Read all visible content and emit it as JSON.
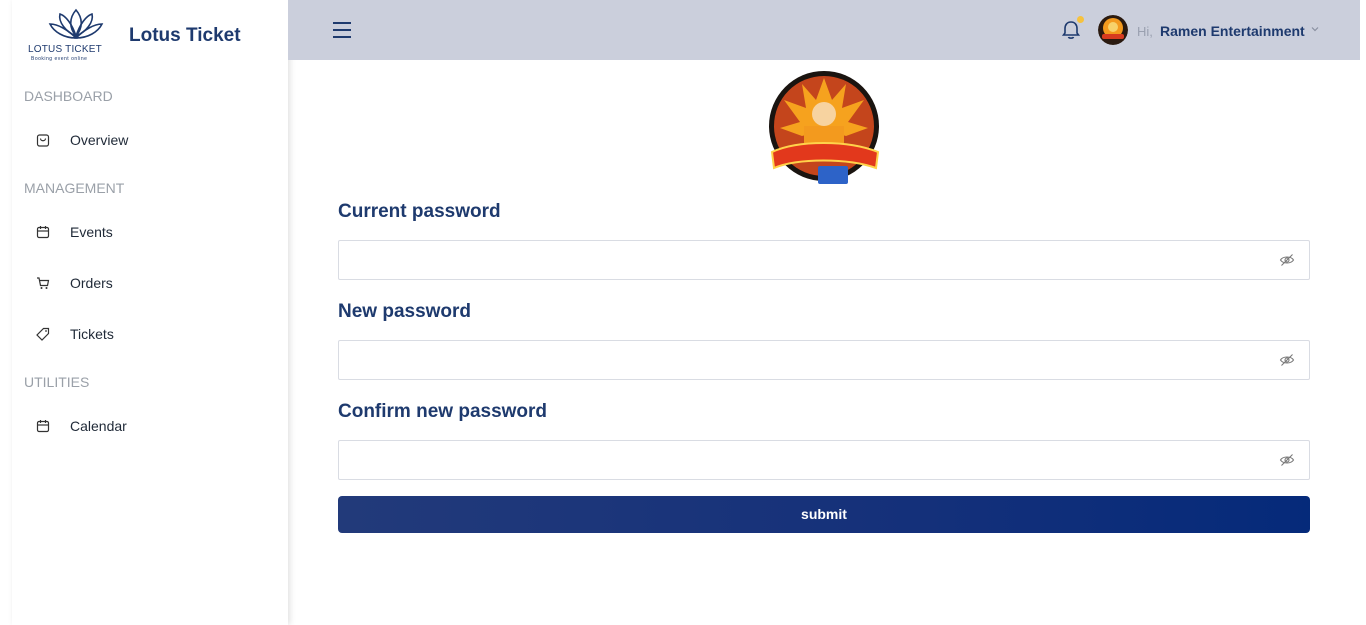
{
  "brand": {
    "logo_text": "LOTUS TICKET",
    "logo_subtext": "Booking event online",
    "name": "Lotus Ticket"
  },
  "sidebar": {
    "sections": [
      {
        "title": "DASHBOARD",
        "items": [
          {
            "label": "Overview",
            "icon": "shopping-bag-icon"
          }
        ]
      },
      {
        "title": "MANAGEMENT",
        "items": [
          {
            "label": "Events",
            "icon": "calendar-icon"
          },
          {
            "label": "Orders",
            "icon": "cart-icon"
          },
          {
            "label": "Tickets",
            "icon": "tag-icon"
          }
        ]
      },
      {
        "title": "UTILITIES",
        "items": [
          {
            "label": "Calendar",
            "icon": "calendar-icon"
          }
        ]
      }
    ]
  },
  "header": {
    "greeting": "Hi,",
    "user_name": "Ramen Entertainment"
  },
  "form": {
    "current_password_label": "Current password",
    "new_password_label": "New password",
    "confirm_password_label": "Confirm new password",
    "submit_label": "submit"
  },
  "colors": {
    "primary": "#1e3a6e",
    "topbar": "#cbcfdc",
    "notification_dot": "#f6c23e",
    "button": "#14307a"
  }
}
